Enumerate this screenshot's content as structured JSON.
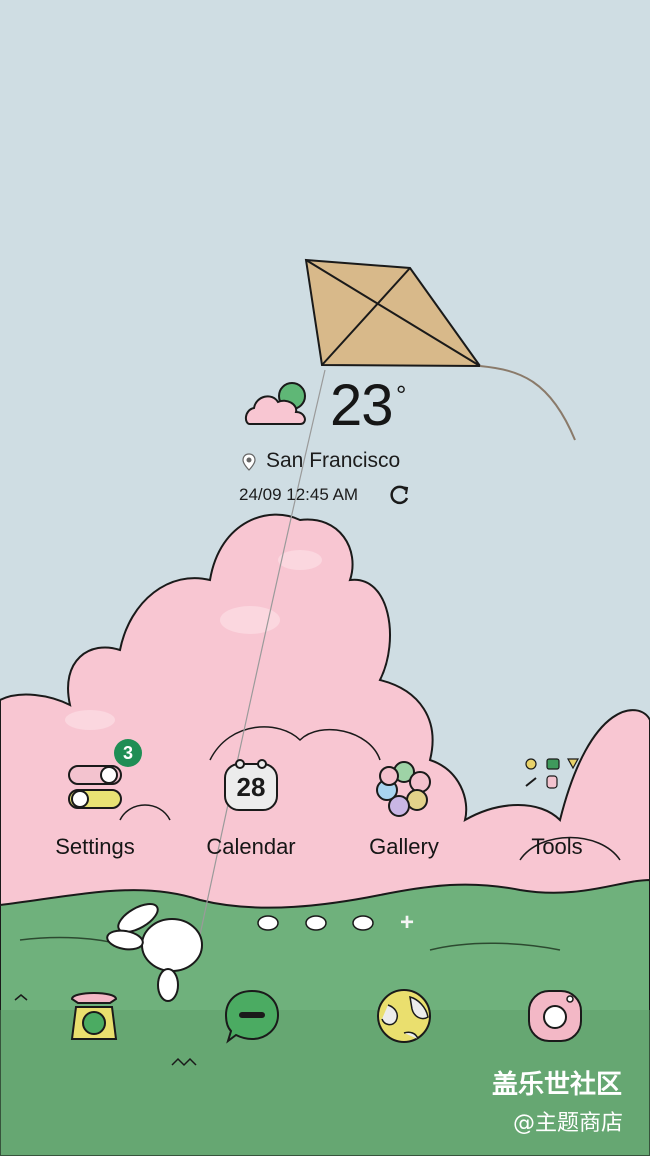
{
  "weather": {
    "temperature": "23",
    "degree_symbol": "°",
    "location": "San Francisco",
    "datetime": "24/09 12:45 AM",
    "icon": "cloud-sun-icon"
  },
  "apps": [
    {
      "label": "Settings",
      "icon": "settings-toggle-icon",
      "badge": "3"
    },
    {
      "label": "Calendar",
      "icon": "calendar-icon",
      "day": "28"
    },
    {
      "label": "Gallery",
      "icon": "gallery-flower-icon"
    },
    {
      "label": "Tools",
      "icon": "tools-folder-icon"
    }
  ],
  "dock": [
    {
      "name": "phone",
      "icon": "phone-icon"
    },
    {
      "name": "messages",
      "icon": "message-icon"
    },
    {
      "name": "browser",
      "icon": "globe-icon"
    },
    {
      "name": "camera",
      "icon": "camera-icon"
    }
  ],
  "page_indicator": {
    "add_page": "+"
  },
  "watermark": {
    "line1": "盖乐世社区",
    "line2": "@主题商店"
  },
  "colors": {
    "sky": "#cfdde3",
    "cloud": "#f8c6d2",
    "grass": "#6aa877",
    "badge": "#1f8e55",
    "kite": "#d8b98a"
  }
}
